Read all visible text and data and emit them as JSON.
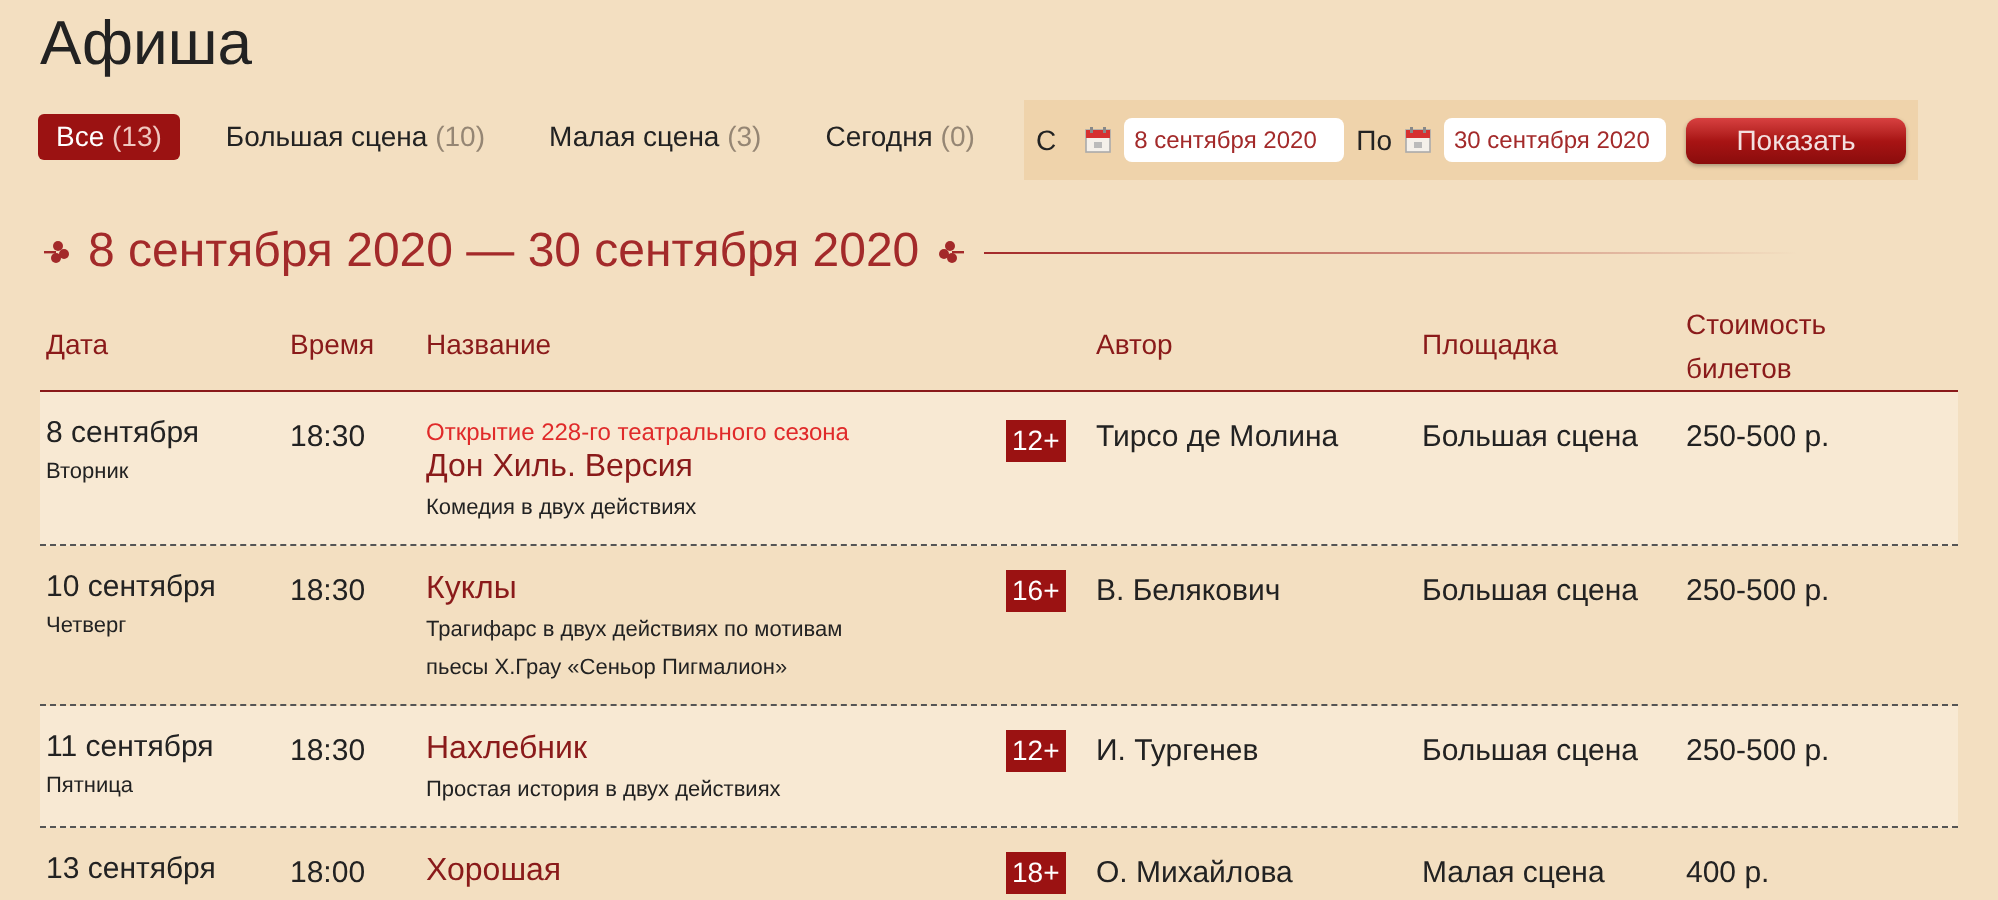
{
  "title": "Афиша",
  "tabs": [
    {
      "label": "Все",
      "count": "(13)",
      "selected": true
    },
    {
      "label": "Большая сцена",
      "count": "(10)",
      "selected": false
    },
    {
      "label": "Малая сцена",
      "count": "(3)",
      "selected": false
    },
    {
      "label": "Сегодня",
      "count": "(0)",
      "selected": false
    }
  ],
  "filter": {
    "from_label": "С",
    "from_value": "8 сентября 2020",
    "to_label": "По",
    "to_value": "30 сентября 2020",
    "button": "Показать"
  },
  "period_heading": "8 сентября 2020 — 30 сентября 2020",
  "table": {
    "columns": [
      "Дата",
      "Время",
      "Название",
      "Автор",
      "Площадка",
      "Стоимость билетов"
    ],
    "rows": [
      {
        "date": "8 сентября",
        "weekday": "Вторник",
        "time": "18:30",
        "note": "Открытие 228-го театрального сезона",
        "name": "Дон Хиль. Версия",
        "description": "Комедия в двух действиях",
        "age": "12+",
        "author": "Тирсо де Молина",
        "venue": "Большая сцена",
        "price": "250-500 р."
      },
      {
        "date": "10 сентября",
        "weekday": "Четверг",
        "time": "18:30",
        "name": "Куклы",
        "description": "Трагифарс в двух действиях по мотивам пьесы Х.Грау «Сеньор Пигмалион»",
        "age": "16+",
        "author": "В. Белякович",
        "venue": "Большая сцена",
        "price": "250-500 р."
      },
      {
        "date": "11 сентября",
        "weekday": "Пятница",
        "time": "18:30",
        "name": "Нахлебник",
        "description": "Простая история в двух действиях",
        "age": "12+",
        "author": "И. Тургенев",
        "venue": "Большая сцена",
        "price": "250-500 р."
      },
      {
        "date": "13 сентября",
        "time": "18:00",
        "name": "Хорошая",
        "age": "18+",
        "author": "О. Михайлова",
        "venue": "Малая сцена",
        "price": "400 р."
      }
    ]
  }
}
